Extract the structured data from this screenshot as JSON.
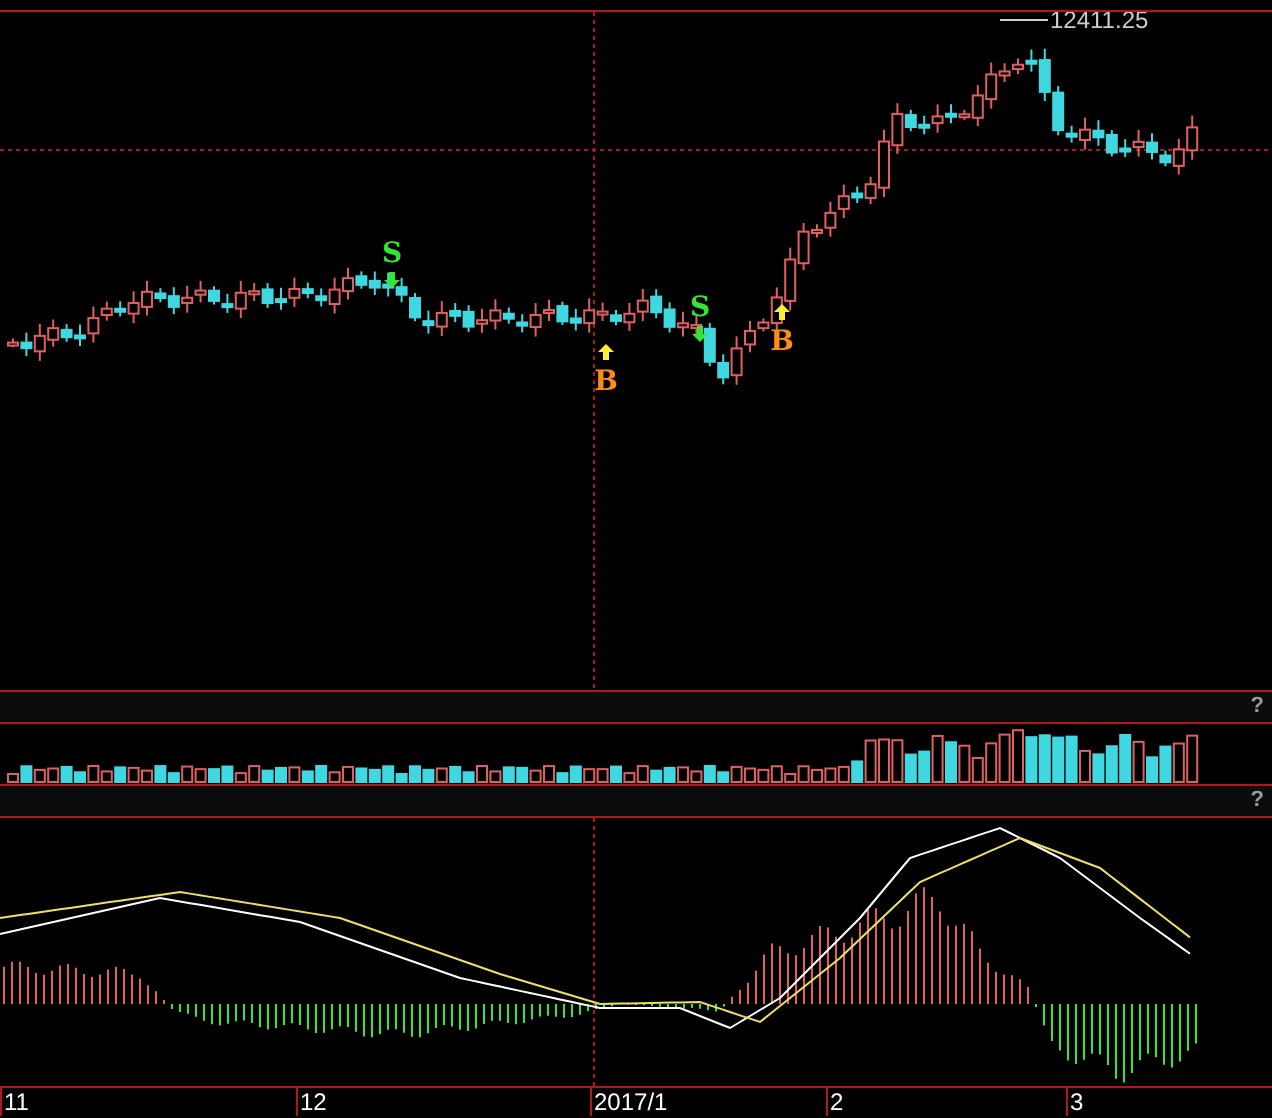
{
  "price_chart": {
    "high_label": "12411.25",
    "signals": [
      {
        "kind": "sell",
        "label": "S"
      },
      {
        "kind": "buy",
        "label": "B"
      },
      {
        "kind": "sell",
        "label": "S"
      },
      {
        "kind": "buy",
        "label": "B"
      }
    ]
  },
  "volume_header": {
    "help": "?"
  },
  "indicator_header": {
    "help": "?"
  },
  "time_axis": {
    "labels": [
      "11",
      "12",
      "2017/1",
      "2",
      "3"
    ]
  }
}
